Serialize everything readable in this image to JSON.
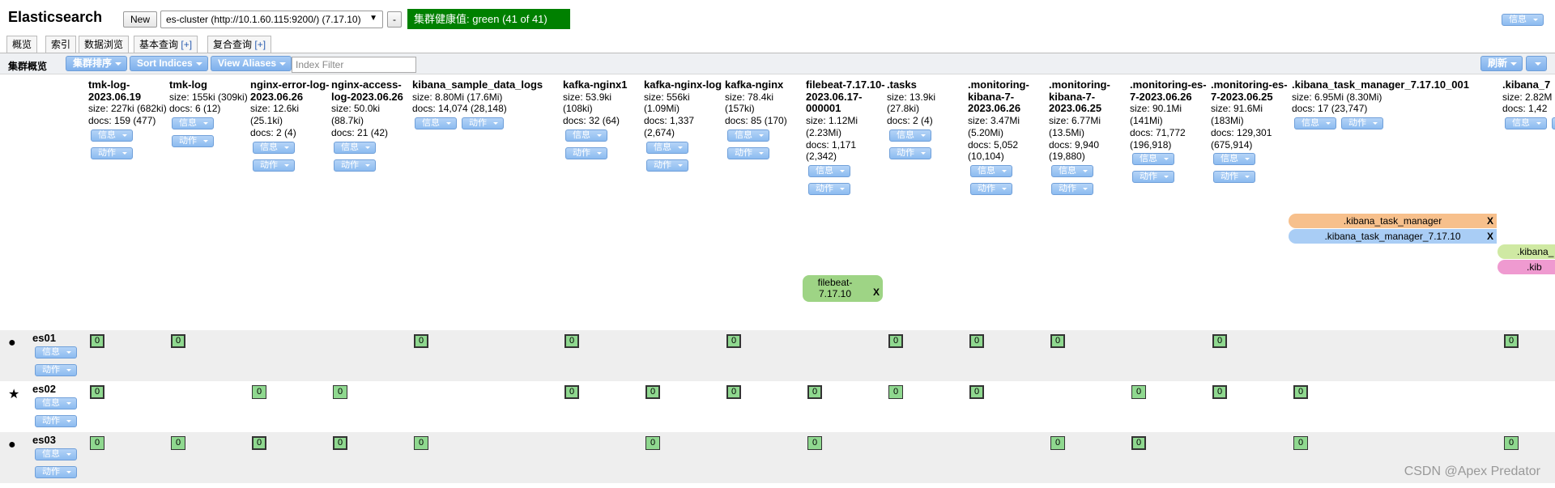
{
  "header": {
    "title": "Elasticsearch",
    "new_label": "New",
    "cluster_select_value": "es-cluster (http://10.1.60.115:9200/) (7.17.10)",
    "minus_label": "-",
    "health": "集群健康值: green (41 of 41)",
    "info_label": "信息"
  },
  "tabs": [
    {
      "label": "概览"
    },
    {
      "label": "索引"
    },
    {
      "label": "数据浏览"
    },
    {
      "label": "基本查询",
      "plus": "[+]"
    },
    {
      "label": "复合查询",
      "plus": "[+]"
    }
  ],
  "toolbar": {
    "title": "集群概览",
    "sort_cluster": "集群排序",
    "sort_indices": "Sort Indices",
    "view_aliases": "View Aliases",
    "index_filter_placeholder": "Index Filter",
    "refresh": "刷新"
  },
  "buttons": {
    "info": "信息",
    "action": "动作"
  },
  "indices": [
    {
      "name": "tmk-log-2023.06.19",
      "size": "size: 227ki (682ki)",
      "docs": "docs: 159 (477)"
    },
    {
      "name": "tmk-log",
      "size": "size: 155ki (309ki)",
      "docs": "docs: 6 (12)"
    },
    {
      "name": "nginx-error-log-2023.06.26",
      "size": "size: 12.6ki (25.1ki)",
      "docs": "docs: 2 (4)"
    },
    {
      "name": "nginx-access-log-2023.06.26",
      "size": "size: 50.0ki (88.7ki)",
      "docs": "docs: 21 (42)"
    },
    {
      "name": "kibana_sample_data_logs",
      "size": "size: 8.80Mi (17.6Mi)",
      "docs": "docs: 14,074 (28,148)"
    },
    {
      "name": "kafka-nginx1",
      "size": "size: 53.9ki (108ki)",
      "docs": "docs: 32 (64)"
    },
    {
      "name": "kafka-nginx-log",
      "size": "size: 556ki (1.09Mi)",
      "docs": "docs: 1,337 (2,674)"
    },
    {
      "name": "kafka-nginx",
      "size": "size: 78.4ki (157ki)",
      "docs": "docs: 85 (170)"
    },
    {
      "name": "filebeat-7.17.10-2023.06.17-000001",
      "size": "size: 1.12Mi (2.23Mi)",
      "docs": "docs: 1,171 (2,342)"
    },
    {
      "name": ".tasks",
      "size": "size: 13.9ki (27.8ki)",
      "docs": "docs: 2 (4)"
    },
    {
      "name": ".monitoring-kibana-7-2023.06.26",
      "size": "size: 3.47Mi (5.20Mi)",
      "docs": "docs: 5,052 (10,104)"
    },
    {
      "name": ".monitoring-kibana-7-2023.06.25",
      "size": "size: 6.77Mi (13.5Mi)",
      "docs": "docs: 9,940 (19,880)"
    },
    {
      "name": ".monitoring-es-7-2023.06.26",
      "size": "size: 90.1Mi (141Mi)",
      "docs": "docs: 71,772 (196,918)"
    },
    {
      "name": ".monitoring-es-7-2023.06.25",
      "size": "size: 91.6Mi (183Mi)",
      "docs": "docs: 129,301 (675,914)"
    },
    {
      "name": ".kibana_task_manager_7.17.10_001",
      "size": "size: 6.95Mi (8.30Mi)",
      "docs": "docs: 17 (23,747)"
    },
    {
      "name": ".kibana_7",
      "size": "size: 2.82M",
      "docs": "docs: 1,42"
    }
  ],
  "aliases": [
    {
      "label": ".kibana_task_manager",
      "x": "X",
      "color": "#f7c08c"
    },
    {
      "label": ".kibana_task_manager_7.17.10",
      "x": "X",
      "color": "#a9cdf5"
    },
    {
      "label": "filebeat-7.17.10",
      "x": "X",
      "color": "#9ed485"
    },
    {
      "label": ".kibana_",
      "color": "#cfe9a3"
    },
    {
      "label": ".kib",
      "color": "#ef9ad0"
    }
  ],
  "nodes": [
    {
      "name": "es01",
      "icon": "●"
    },
    {
      "name": "es02",
      "icon": "★"
    },
    {
      "name": "es03",
      "icon": "●"
    }
  ],
  "shard_label": "0",
  "watermark": "CSDN @Apex  Predator"
}
